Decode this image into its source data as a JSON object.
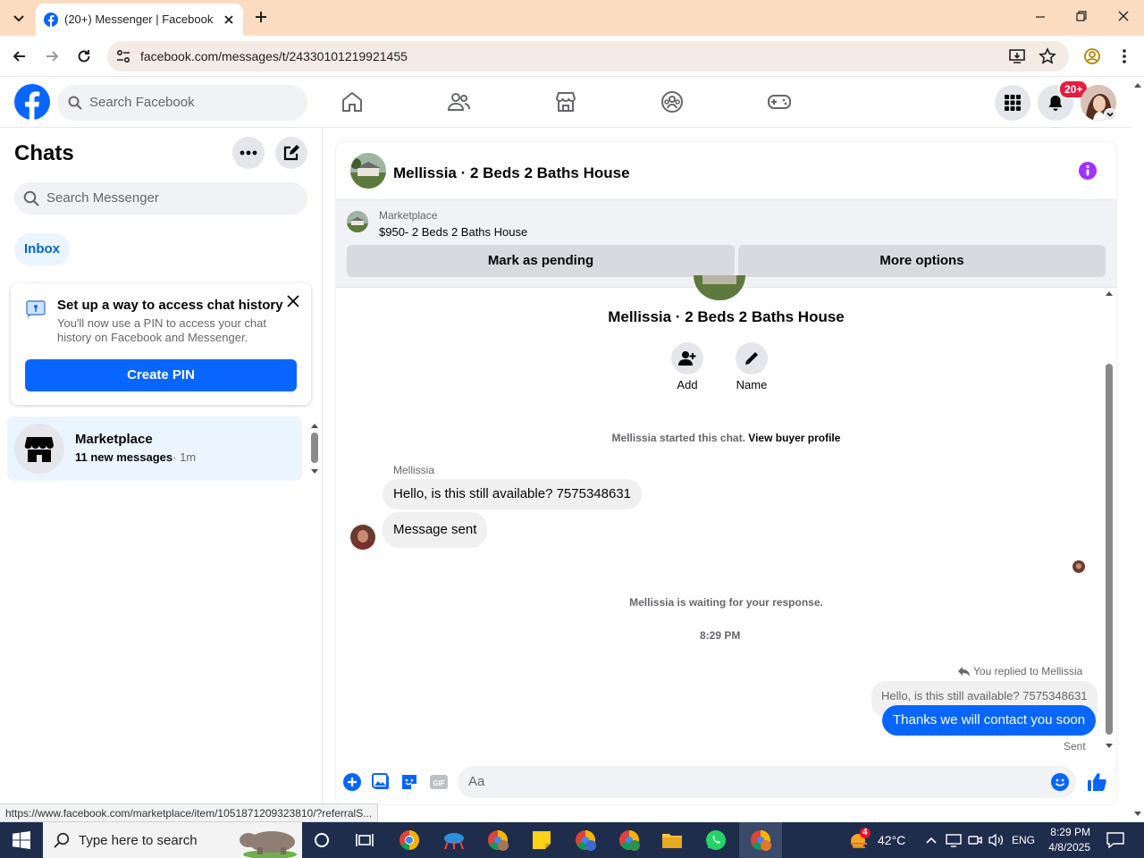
{
  "browser": {
    "tab_title": "(20+) Messenger | Facebook",
    "url": "facebook.com/messages/t/24330101219921455",
    "status_url": "https://www.facebook.com/marketplace/item/1051871209323810/?referralS..."
  },
  "fb": {
    "search_placeholder": "Search Facebook",
    "notification_badge": "20+"
  },
  "sidebar": {
    "title": "Chats",
    "search_placeholder": "Search Messenger",
    "filter": "Inbox",
    "pin_card": {
      "heading": "Set up a way to access chat history",
      "description": "You'll now use a PIN to access your chat history on Facebook and Messenger.",
      "button": "Create PIN"
    },
    "chat": {
      "name": "Marketplace",
      "unread": "11 new messages",
      "time": "· 1m"
    }
  },
  "conversation": {
    "title": "Mellissia · 2 Beds 2 Baths House",
    "marketplace_label": "Marketplace",
    "listing": "$950- 2 Beds 2 Baths House",
    "pending_button": "Mark as pending",
    "more_button": "More options",
    "profile_title": "Mellissia · 2 Beds 2 Baths House",
    "add_label": "Add",
    "name_label": "Name",
    "started_text": "Mellissia started this chat.",
    "view_profile": "View buyer profile",
    "sender_name": "Mellissia",
    "msg1": "Hello, is this still available? 7575348631",
    "msg2": "Message sent",
    "waiting": "Mellissia is waiting for your response.",
    "time": "8:29 PM",
    "replied_to": "You replied to Mellissia",
    "quoted": "Hello, is this still available? 7575348631",
    "reply": "Thanks we will contact you soon",
    "sent_status": "Sent",
    "composer_placeholder": "Aa"
  },
  "taskbar": {
    "search_placeholder": "Type here to search",
    "weather_badge": "4",
    "temperature": "42°C",
    "language": "ENG",
    "clock_time": "8:29 PM",
    "clock_date": "4/8/2025"
  },
  "colors": {
    "fb_blue": "#0866ff",
    "badge_red": "#e41e3f",
    "info_purple": "#a033ff",
    "tab_bar": "#fcdcc0"
  }
}
